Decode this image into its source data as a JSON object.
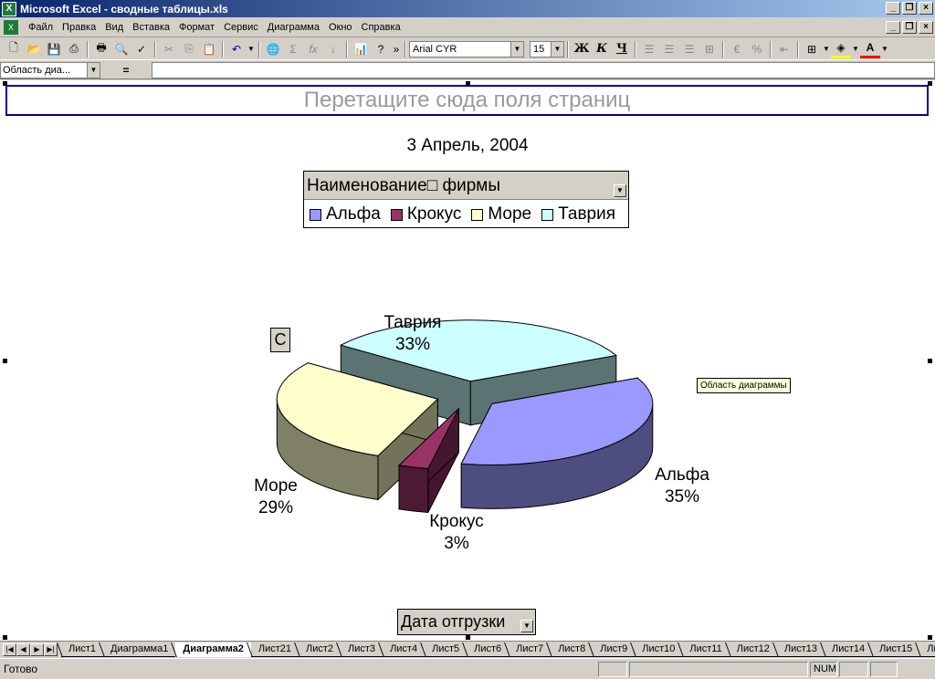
{
  "window": {
    "title": "Microsoft Excel - сводные таблицы.xls",
    "app_icon": "excel-icon"
  },
  "menu": {
    "items": [
      "Файл",
      "Правка",
      "Вид",
      "Вставка",
      "Формат",
      "Сервис",
      "Диаграмма",
      "Окно",
      "Справка"
    ]
  },
  "toolbar": {
    "font_name": "Arial CYR",
    "font_size": "15",
    "bold_label": "Ж",
    "italic_label": "К",
    "underline_label": "Ч"
  },
  "formula_bar": {
    "name_box": "Область диа...",
    "equals": "="
  },
  "chart": {
    "page_field_prompt": "Перетащите сюда поля страниц",
    "date_title": "3 Апрель, 2004",
    "legend_field": "Наименование□ фирмы",
    "c_button": "С",
    "tooltip": "Область диаграммы",
    "category_field": "Дата отгрузки"
  },
  "chart_data": {
    "type": "pie",
    "title": "3 Апрель, 2004",
    "categories": [
      "Альфа",
      "Крокус",
      "Море",
      "Таврия"
    ],
    "values": [
      35,
      3,
      29,
      33
    ],
    "value_labels": [
      "35%",
      "3%",
      "29%",
      "33%"
    ],
    "colors": [
      "#9999ff",
      "#993366",
      "#ffffcc",
      "#ccffff"
    ],
    "legend_placement": "top"
  },
  "sheet_tabs": {
    "tabs": [
      "Лист1",
      "Диаграмма1",
      "Диаграмма2",
      "Лист21",
      "Лист2",
      "Лист3",
      "Лист4",
      "Лист5",
      "Лист6",
      "Лист7",
      "Лист8",
      "Лист9",
      "Лист10",
      "Лист11",
      "Лист12",
      "Лист13",
      "Лист14",
      "Лист15",
      "Ли"
    ],
    "active": "Диаграмма2"
  },
  "status": {
    "text": "Готово",
    "num": "NUM"
  }
}
